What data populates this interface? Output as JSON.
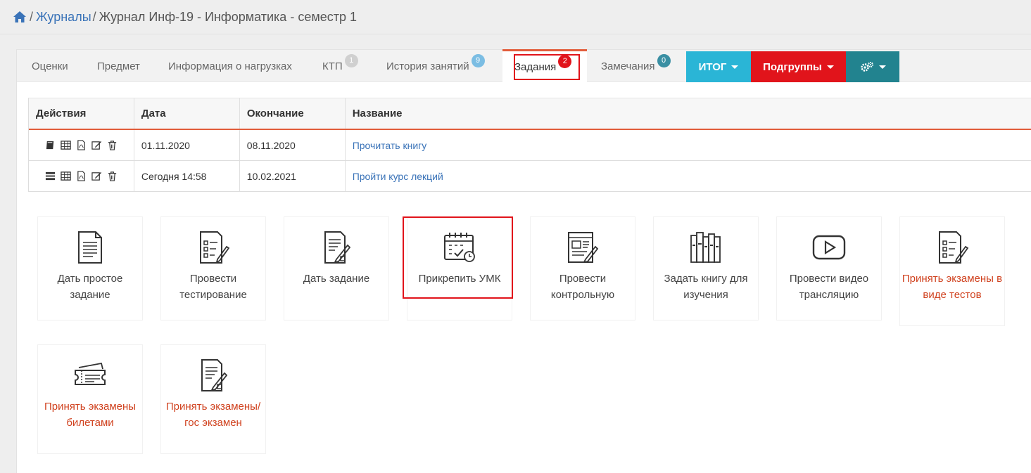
{
  "breadcrumb": {
    "home_icon": "home-icon",
    "items": [
      "Журналы",
      "Журнал Инф-19 - Информатика - семестр 1"
    ],
    "separator": "/"
  },
  "tabs": [
    {
      "label": "Оценки"
    },
    {
      "label": "Предмет"
    },
    {
      "label": "Информация о нагрузках"
    },
    {
      "label": "КТП",
      "badge": "1",
      "badge_color": "#d0d0d0"
    },
    {
      "label": "История занятий",
      "badge": "9",
      "badge_color": "#7bbde3"
    },
    {
      "label": "Задания",
      "badge": "2",
      "badge_color": "#e1141b",
      "active": true
    },
    {
      "label": "Замечания",
      "badge": "0",
      "badge_color": "#3a8fa3"
    }
  ],
  "buttons": [
    {
      "label": "ИТОГ",
      "color": "#2ab5d6"
    },
    {
      "label": "Подгруппы",
      "color": "#e1141b"
    },
    {
      "label": "",
      "icon": "gears-icon",
      "color": "#22838f"
    }
  ],
  "table": {
    "headers": [
      "Действия",
      "Дата",
      "Окончание",
      "Название"
    ],
    "rows": [
      {
        "date": "01.11.2020",
        "end": "08.11.2020",
        "name": "Прочитать книгу",
        "first_icon": "book-icon"
      },
      {
        "date": "Сегодня 14:58",
        "end": "10.02.2021",
        "name": "Пройти курс лекций",
        "first_icon": "list-icon"
      }
    ],
    "action_icons": [
      "table-icon",
      "pdf-icon",
      "edit-icon",
      "trash-icon"
    ]
  },
  "cards": [
    {
      "label": "Дать простое задание",
      "icon": "document-icon"
    },
    {
      "label": "Провести тестирование",
      "icon": "checklist-pen-icon"
    },
    {
      "label": "Дать задание",
      "icon": "document-pen-icon"
    },
    {
      "label": "Прикрепить УМК",
      "icon": "calendar-check-icon",
      "highlighted": true
    },
    {
      "label": "Провести контрольную",
      "icon": "newspaper-pen-icon"
    },
    {
      "label": "Задать книгу для изучения",
      "icon": "books-icon"
    },
    {
      "label": "Провести видео трансляцию",
      "icon": "play-icon"
    },
    {
      "label": "Принять экзамены в виде тестов",
      "icon": "checklist-pen-icon",
      "red": true
    },
    {
      "label": "Принять экзамены билетами",
      "icon": "tickets-icon",
      "red": true
    },
    {
      "label": "Принять экзамены/гос экзамен",
      "icon": "document-pen-icon",
      "red": true
    }
  ],
  "colors": {
    "accent": "#e25d3b",
    "link": "#3a73b8",
    "highlight": "#e1141b"
  }
}
